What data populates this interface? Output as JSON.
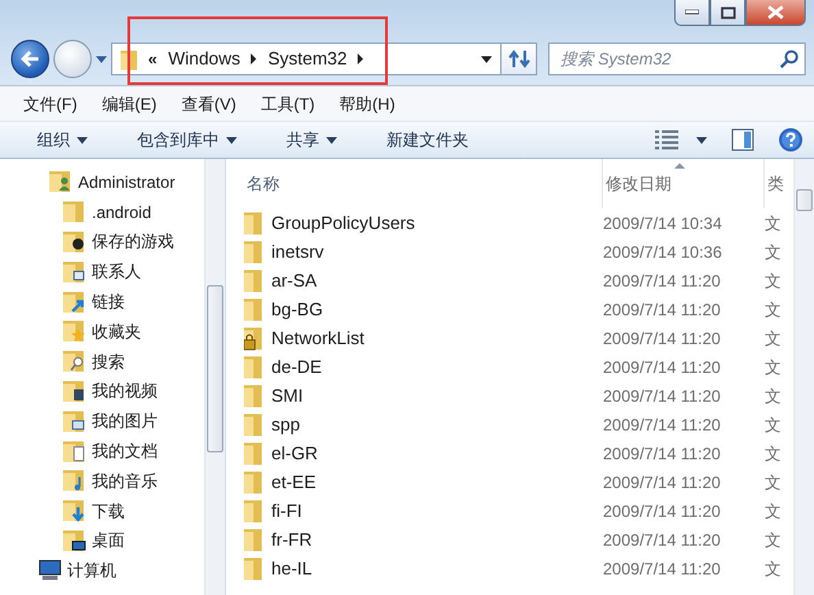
{
  "address_bar": {
    "overflow": "«",
    "segments": [
      "Windows",
      "System32"
    ],
    "highlighted": true
  },
  "search": {
    "placeholder": "搜索 System32"
  },
  "menu": [
    "文件(F)",
    "编辑(E)",
    "查看(V)",
    "工具(T)",
    "帮助(H)"
  ],
  "toolbar": [
    {
      "label": "组织",
      "dropdown": true
    },
    {
      "label": "包含到库中",
      "dropdown": true
    },
    {
      "label": "共享",
      "dropdown": true
    },
    {
      "label": "新建文件夹",
      "dropdown": false
    }
  ],
  "sidebar": {
    "items": [
      {
        "label": "Administrator",
        "kind": "user",
        "children": [
          {
            "label": ".android",
            "kind": "folder"
          },
          {
            "label": "保存的游戏",
            "kind": "games"
          },
          {
            "label": "联系人",
            "kind": "contacts"
          },
          {
            "label": "链接",
            "kind": "links"
          },
          {
            "label": "收藏夹",
            "kind": "favorites"
          },
          {
            "label": "搜索",
            "kind": "search"
          },
          {
            "label": "我的视频",
            "kind": "videos"
          },
          {
            "label": "我的图片",
            "kind": "pictures"
          },
          {
            "label": "我的文档",
            "kind": "documents"
          },
          {
            "label": "我的音乐",
            "kind": "music"
          },
          {
            "label": "下载",
            "kind": "downloads"
          },
          {
            "label": "桌面",
            "kind": "desktop"
          }
        ]
      },
      {
        "label": "计算机",
        "kind": "computer"
      }
    ]
  },
  "table": {
    "columns": [
      {
        "label": "名称",
        "sorted": false
      },
      {
        "label": "修改日期",
        "sorted": true
      },
      {
        "label": "类",
        "sorted": false
      }
    ],
    "rows": [
      {
        "name": "GroupPolicyUsers",
        "locked": false,
        "date": "2009/7/14 10:34",
        "type": "文"
      },
      {
        "name": "inetsrv",
        "locked": false,
        "date": "2009/7/14 10:36",
        "type": "文"
      },
      {
        "name": "ar-SA",
        "locked": false,
        "date": "2009/7/14 11:20",
        "type": "文"
      },
      {
        "name": "bg-BG",
        "locked": false,
        "date": "2009/7/14 11:20",
        "type": "文"
      },
      {
        "name": "NetworkList",
        "locked": true,
        "date": "2009/7/14 11:20",
        "type": "文"
      },
      {
        "name": "de-DE",
        "locked": false,
        "date": "2009/7/14 11:20",
        "type": "文"
      },
      {
        "name": "SMI",
        "locked": false,
        "date": "2009/7/14 11:20",
        "type": "文"
      },
      {
        "name": "spp",
        "locked": false,
        "date": "2009/7/14 11:20",
        "type": "文"
      },
      {
        "name": "el-GR",
        "locked": false,
        "date": "2009/7/14 11:20",
        "type": "文"
      },
      {
        "name": "et-EE",
        "locked": false,
        "date": "2009/7/14 11:20",
        "type": "文"
      },
      {
        "name": "fi-FI",
        "locked": false,
        "date": "2009/7/14 11:20",
        "type": "文"
      },
      {
        "name": "fr-FR",
        "locked": false,
        "date": "2009/7/14 11:20",
        "type": "文"
      },
      {
        "name": "he-IL",
        "locked": false,
        "date": "2009/7/14 11:20",
        "type": "文"
      }
    ]
  }
}
